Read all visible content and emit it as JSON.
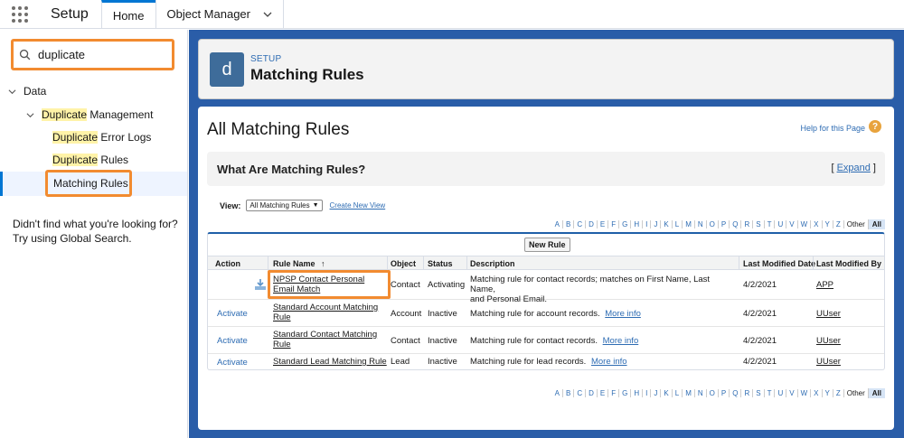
{
  "topbar": {
    "app_name": "Setup",
    "tabs": [
      {
        "label": "Home"
      },
      {
        "label": "Object Manager"
      }
    ]
  },
  "sidebar": {
    "search_value": "duplicate",
    "tree": {
      "data": {
        "label": "Data"
      },
      "dup_mgmt": {
        "hl": "Duplicate",
        "rest": " Management"
      },
      "dup_error_logs": {
        "hl": "Duplicate",
        "rest": " Error Logs"
      },
      "dup_rules": {
        "hl": "Duplicate",
        "rest": " Rules"
      },
      "matching_rules": {
        "label": "Matching Rules"
      }
    },
    "help_line1": "Didn't find what you're looking for?",
    "help_line2": "Try using Global Search."
  },
  "header": {
    "icon_letter": "d",
    "kicker": "SETUP",
    "title": "Matching Rules"
  },
  "content": {
    "page_title": "All Matching Rules",
    "help_link": "Help for this Page",
    "help_icon": "?",
    "info_title": "What Are Matching Rules?",
    "expand_open": "[ ",
    "expand_label": "Expand",
    "expand_close": " ]",
    "view_label": "View:",
    "view_selected": "All Matching Rules",
    "create_view": "Create New View",
    "alpha": [
      "A",
      "B",
      "C",
      "D",
      "E",
      "F",
      "G",
      "H",
      "I",
      "J",
      "K",
      "L",
      "M",
      "N",
      "O",
      "P",
      "Q",
      "R",
      "S",
      "T",
      "U",
      "V",
      "W",
      "X",
      "Y",
      "Z"
    ],
    "alpha_other": "Other",
    "alpha_all": "All",
    "new_rule_label": "New Rule",
    "columns": {
      "action": "Action",
      "rule_name": "Rule Name",
      "sort_arrow": "↑",
      "object": "Object",
      "status": "Status",
      "description": "Description",
      "last_modified_date": "Last Modified Date",
      "last_modified_by": "Last Modified By"
    },
    "rows": [
      {
        "action": "",
        "rule_name_l1": "NPSP Contact Personal",
        "rule_name_l2": "Email Match",
        "object": "Contact",
        "status": "Activating",
        "desc_l1": "Matching rule for contact records; matches on First Name, Last Name,",
        "desc_l2": "and Personal Email.",
        "more": "",
        "date": "4/2/2021",
        "by": "APP"
      },
      {
        "action": "Activate",
        "rule_name_l1": "Standard Account Matching",
        "rule_name_l2": "Rule",
        "object": "Account",
        "status": "Inactive",
        "desc_l1": "Matching rule for account records.",
        "desc_l2": "",
        "more": "More info",
        "date": "4/2/2021",
        "by": "UUser"
      },
      {
        "action": "Activate",
        "rule_name_l1": "Standard Contact Matching",
        "rule_name_l2": "Rule",
        "object": "Contact",
        "status": "Inactive",
        "desc_l1": "Matching rule for contact records.",
        "desc_l2": "",
        "more": "More info",
        "date": "4/2/2021",
        "by": "UUser"
      },
      {
        "action": "Activate",
        "rule_name_l1": "Standard Lead Matching Rule",
        "rule_name_l2": "",
        "object": "Lead",
        "status": "Inactive",
        "desc_l1": "Matching rule for lead records.",
        "desc_l2": "",
        "more": "More info",
        "date": "4/2/2021",
        "by": "UUser"
      }
    ]
  },
  "colors": {
    "brand_blue": "#0176d3",
    "main_bg": "#2a5da8",
    "highlight_box": "#f28b30",
    "search_highlight": "#fff3a8"
  },
  "icons": [
    "app-launcher-icon",
    "chevron-down-icon",
    "search-icon",
    "tree-toggle-icon",
    "help-icon",
    "download-icon"
  ]
}
